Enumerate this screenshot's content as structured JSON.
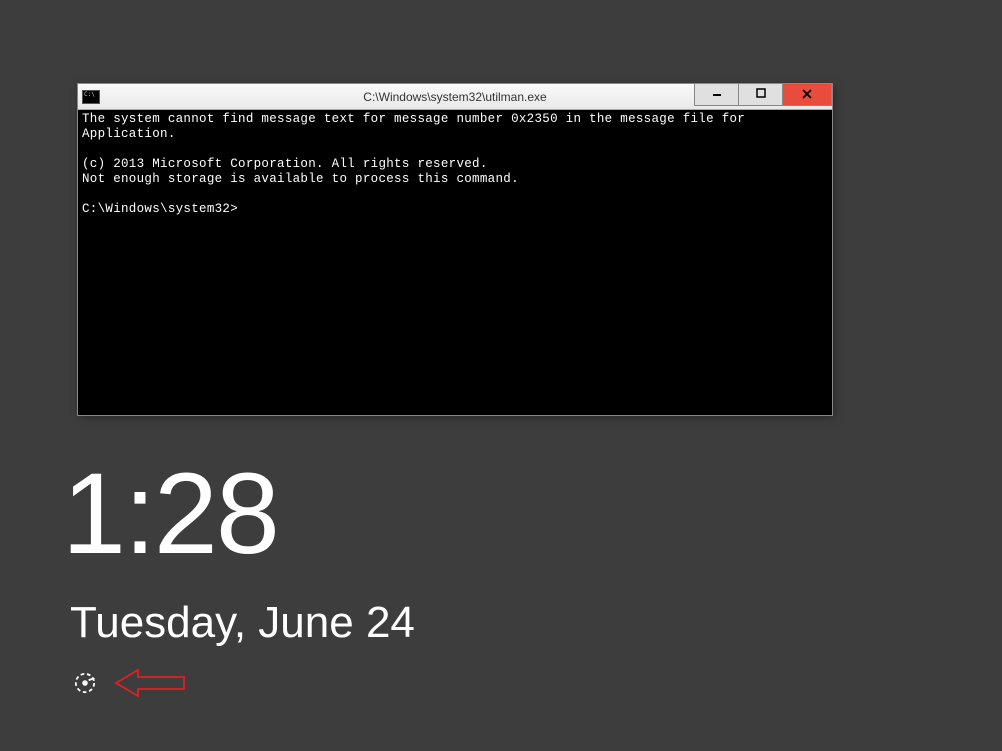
{
  "window": {
    "icon_label": "C:\\",
    "title": "C:\\Windows\\system32\\utilman.exe",
    "controls": {
      "minimize": "─",
      "maximize": "☐",
      "close": "✕"
    }
  },
  "console": {
    "line1": "The system cannot find message text for message number 0x2350 in the message file for Application.",
    "blank1": "",
    "line2": "(c) 2013 Microsoft Corporation. All rights reserved.",
    "line3": "Not enough storage is available to process this command.",
    "blank2": "",
    "prompt": "C:\\Windows\\system32>"
  },
  "lockscreen": {
    "time": "1:28",
    "date": "Tuesday, June 24"
  },
  "icons": {
    "ease_of_access": "ease-of-access-icon",
    "arrow": "arrow-left-annotation"
  }
}
